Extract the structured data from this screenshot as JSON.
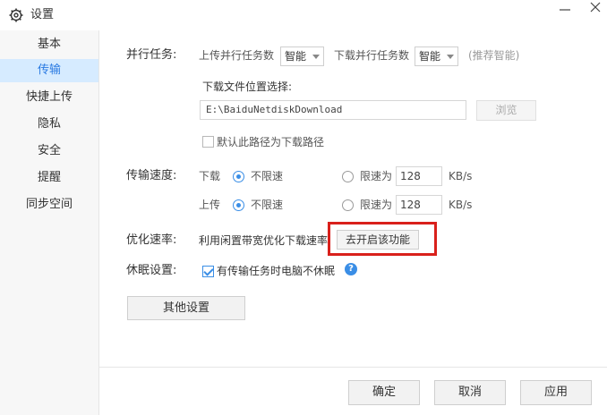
{
  "window": {
    "title": "设置",
    "icon": "gear-icon"
  },
  "sidebar": {
    "items": [
      {
        "label": "基本",
        "active": false
      },
      {
        "label": "传输",
        "active": true
      },
      {
        "label": "快捷上传",
        "active": false
      },
      {
        "label": "隐私",
        "active": false
      },
      {
        "label": "安全",
        "active": false
      },
      {
        "label": "提醒",
        "active": false
      },
      {
        "label": "同步空间",
        "active": false
      }
    ]
  },
  "parallel": {
    "label": "并行任务:",
    "upload_label": "上传并行任务数",
    "upload_value": "智能",
    "download_label": "下载并行任务数",
    "download_value": "智能",
    "hint": "(推荐智能)"
  },
  "download_location": {
    "label": "下载文件位置选择:",
    "path": "E:\\BaiduNetdiskDownload",
    "browse_label": "浏览",
    "default_checkbox_label": "默认此路径为下载路径",
    "default_checked": false
  },
  "speed": {
    "label": "传输速度:",
    "download": {
      "label": "下载",
      "unlimited_label": "不限速",
      "limit_label": "限速为",
      "limit_value": "128",
      "unit": "KB/s",
      "unlimited_checked": true
    },
    "upload": {
      "label": "上传",
      "unlimited_label": "不限速",
      "limit_label": "限速为",
      "limit_value": "128",
      "unit": "KB/s",
      "unlimited_checked": true
    }
  },
  "optimize": {
    "label": "优化速率:",
    "text": "利用闲置带宽优化下载速率",
    "button_label": "去开启该功能"
  },
  "sleep": {
    "label": "休眠设置:",
    "checkbox_label": "有传输任务时电脑不休眠",
    "checked": true
  },
  "other_settings_label": "其他设置",
  "footer": {
    "ok_label": "确定",
    "cancel_label": "取消",
    "apply_label": "应用"
  },
  "colors": {
    "accent": "#3a8ee6",
    "active_bg": "#d6ebff",
    "highlight": "#d9201b"
  }
}
